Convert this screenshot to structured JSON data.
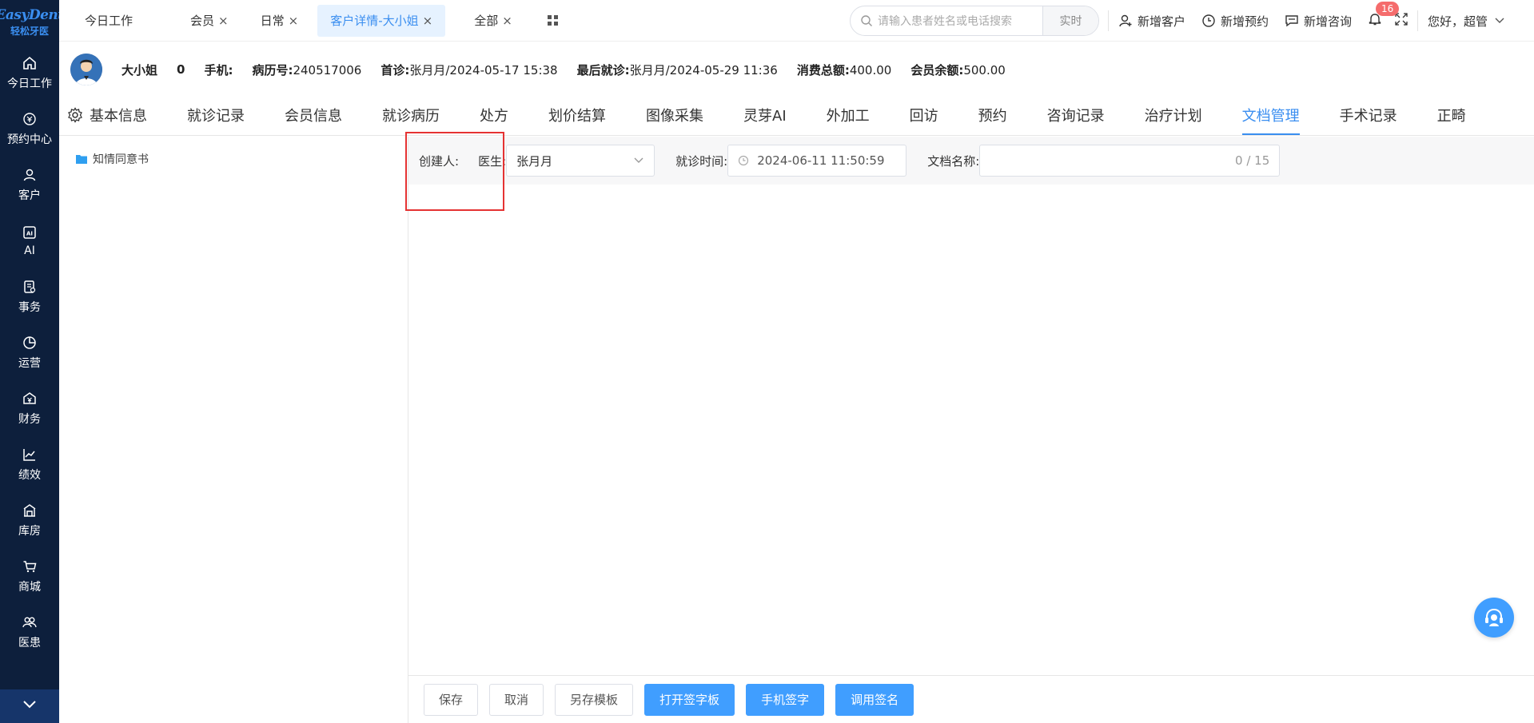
{
  "sidebar": {
    "logo_top": "EasyDent",
    "logo_bottom": "轻松牙医",
    "items": [
      {
        "label": "今日工作",
        "icon": "home-icon"
      },
      {
        "label": "预约中心",
        "icon": "calendar-icon"
      },
      {
        "label": "客户",
        "icon": "user-icon"
      },
      {
        "label": "AI",
        "icon": "ai-icon"
      },
      {
        "label": "事务",
        "icon": "document-icon"
      },
      {
        "label": "运营",
        "icon": "pie-chart-icon"
      },
      {
        "label": "财务",
        "icon": "money-icon"
      },
      {
        "label": "绩效",
        "icon": "line-chart-icon"
      },
      {
        "label": "库房",
        "icon": "warehouse-icon"
      },
      {
        "label": "商城",
        "icon": "cart-icon"
      },
      {
        "label": "医患",
        "icon": "users-icon"
      }
    ]
  },
  "topbar": {
    "tabs": [
      {
        "label": "今日工作",
        "closable": false
      },
      {
        "label": "会员",
        "closable": true
      },
      {
        "label": "日常",
        "closable": true
      },
      {
        "label": "客户详情-大小姐",
        "closable": true,
        "active": true
      },
      {
        "label": "全部",
        "closable": true
      }
    ],
    "close_glyph": "×",
    "search_placeholder": "请输入患者姓名或电话搜索",
    "search_button": "实时",
    "actions": {
      "new_customer": "新增客户",
      "new_appointment": "新增预约",
      "new_consult": "新增咨询"
    },
    "notification_count": "16",
    "greeting": "您好，超管"
  },
  "patient": {
    "name": "大小姐",
    "age": "0",
    "phone_label": "手机:",
    "record_label": "病历号:",
    "record_value": "240517006",
    "first_visit_label": "首诊:",
    "first_visit_value": "张月月/2024-05-17 15:38",
    "last_visit_label": "最后就诊:",
    "last_visit_value": "张月月/2024-05-29 11:36",
    "total_spend_label": "消费总额:",
    "total_spend_value": "400.00",
    "balance_label": "会员余额:",
    "balance_value": "500.00"
  },
  "subtabs": [
    "基本信息",
    "就诊记录",
    "会员信息",
    "就诊病历",
    "处方",
    "划价结算",
    "图像采集",
    "灵芽AI",
    "外加工",
    "回访",
    "预约",
    "咨询记录",
    "治疗计划",
    "文档管理",
    "手术记录",
    "正畸"
  ],
  "active_subtab": "文档管理",
  "tree": {
    "items": [
      "知情同意书"
    ]
  },
  "form": {
    "creator_label": "创建人:",
    "doctor_label": "医生:",
    "doctor_value": "张月月",
    "visit_time_label": "就诊时间:",
    "visit_time_value": "2024-06-11 11:50:59",
    "doc_name_label": "文档名称:",
    "doc_name_count": "0 / 15"
  },
  "footer": {
    "save": "保存",
    "cancel": "取消",
    "save_as_template": "另存模板",
    "open_signature_pad": "打开签字板",
    "mobile_sign": "手机签字",
    "use_signature": "调用签名"
  },
  "colors": {
    "sidebar_bg": "#0d1f3c",
    "accent": "#409eff",
    "highlight_box": "#e53333",
    "badge": "#f56c6c"
  }
}
